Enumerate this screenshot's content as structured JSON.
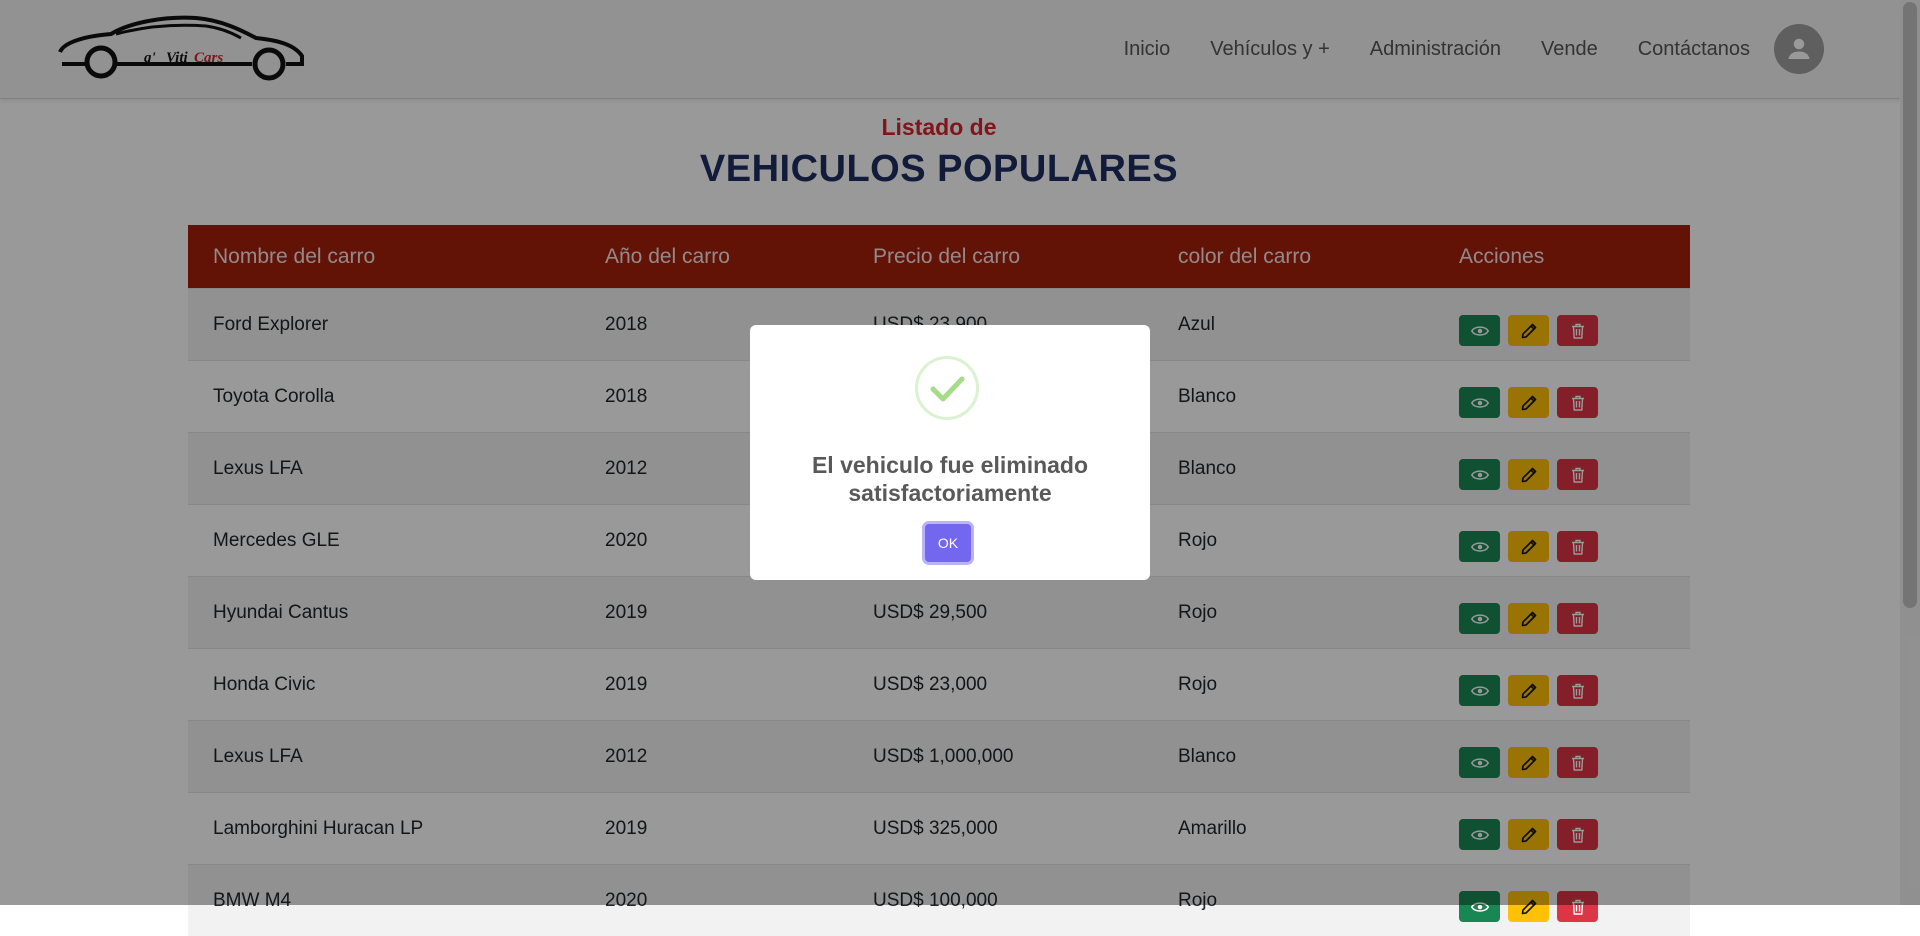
{
  "brand": {
    "logo_text_1": "g'",
    "logo_text_2": "Viti",
    "logo_text_3": "Cars",
    "logo_accent": "#d9232d"
  },
  "nav": {
    "items": [
      {
        "label": "Inicio"
      },
      {
        "label": "Vehículos y +"
      },
      {
        "label": "Administración"
      },
      {
        "label": "Vende"
      },
      {
        "label": "Contáctanos"
      }
    ],
    "avatar_icon": "user-icon"
  },
  "page": {
    "subtitle": "Listado de",
    "title": "VEHICULOS POPULARES"
  },
  "table": {
    "headers": [
      "Nombre del carro",
      "Año del carro",
      "Precio del carro",
      "color del carro",
      "Acciones"
    ],
    "rows": [
      {
        "name": "Ford Explorer",
        "year": "2018",
        "price": "USD$ 23,900",
        "color": "Azul"
      },
      {
        "name": "Toyota Corolla",
        "year": "2018",
        "price": "",
        "color": "Blanco"
      },
      {
        "name": "Lexus LFA",
        "year": "2012",
        "price": "",
        "color": "Blanco"
      },
      {
        "name": "Mercedes GLE",
        "year": "2020",
        "price": "",
        "color": "Rojo"
      },
      {
        "name": "Hyundai Cantus",
        "year": "2019",
        "price": "USD$ 29,500",
        "color": "Rojo"
      },
      {
        "name": "Honda Civic",
        "year": "2019",
        "price": "USD$ 23,000",
        "color": "Rojo"
      },
      {
        "name": "Lexus LFA",
        "year": "2012",
        "price": "USD$ 1,000,000",
        "color": "Blanco"
      },
      {
        "name": "Lamborghini Huracan LP",
        "year": "2019",
        "price": "USD$ 325,000",
        "color": "Amarillo"
      },
      {
        "name": "BMW M4",
        "year": "2020",
        "price": "USD$ 100,000",
        "color": "Rojo"
      }
    ],
    "action_icons": [
      "eye-icon",
      "pencil-icon",
      "trash-icon"
    ],
    "header_color": "#a3200b"
  },
  "modal": {
    "icon": "check-icon",
    "message": "El vehiculo fue eliminado satisfactoriamente",
    "ok_label": "OK",
    "ok_color": "#7367f0"
  }
}
